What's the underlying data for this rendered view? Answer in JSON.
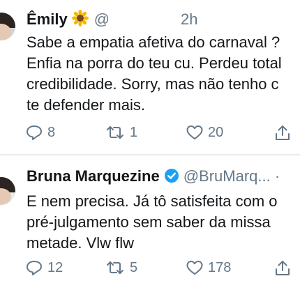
{
  "tweets": [
    {
      "name": "Êmily",
      "emoji": "sunflower-emoji",
      "handle": "@",
      "time": "2h",
      "lines": [
        "Sabe a empatia afetiva do carnaval ?",
        "Enfia na porra do teu cu. Perdeu total",
        "credibilidade. Sorry, mas não tenho c",
        "te defender mais."
      ],
      "replies": "8",
      "retweets": "1",
      "likes": "20"
    },
    {
      "name": "Bruna Marquezine",
      "verified": true,
      "handle": "@BruMarq...",
      "more": "·",
      "lines": [
        "E nem precisa. Já tô satisfeita com o",
        "pré-julgamento sem saber da missa",
        "metade. Vlw flw"
      ],
      "replies": "12",
      "retweets": "5",
      "likes": "178"
    }
  ],
  "colors": {
    "text": "#14171a",
    "secondary": "#657786",
    "verified": "#1da1f2",
    "divider": "#e6ecf0"
  }
}
